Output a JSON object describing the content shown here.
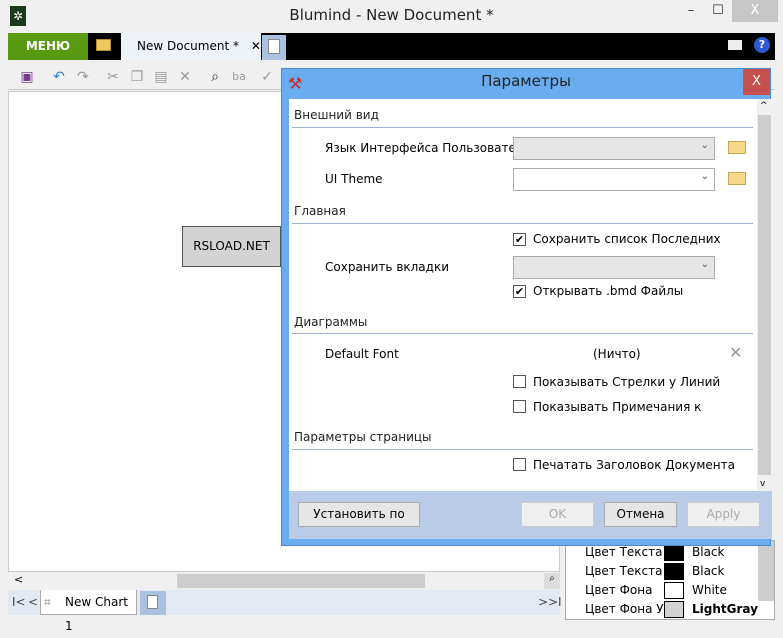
{
  "app": {
    "title": "Blumind - New Document *",
    "minimize": "–",
    "maximize": "☐",
    "close": "X"
  },
  "menubar": {
    "menu_label": "МЕНЮ",
    "doc_tab": "New Document *",
    "doc_tab_close": "✕"
  },
  "canvas": {
    "node_text": "RSLOAD.NET"
  },
  "bottom": {
    "chart_tab": "New Chart 1",
    "first": "I<",
    "prev": "<",
    "next": ">",
    "last": ">I"
  },
  "properties": [
    {
      "label": "Цвет Текста",
      "value": "Black",
      "color": "#000000"
    },
    {
      "label": "Цвет Текста У",
      "value": "Black",
      "color": "#000000"
    },
    {
      "label": "Цвет Фона",
      "value": "White",
      "color": "#ffffff"
    },
    {
      "label": "Цвет Фона Уз.",
      "value": "LightGray",
      "color": "#d3d3d3"
    }
  ],
  "dialog": {
    "title": "Параметры",
    "close": "X",
    "sections": {
      "appearance": "Внешний вид",
      "main": "Главная",
      "charts": "Диаграммы",
      "page": "Параметры страницы"
    },
    "ui_language_label": "Язык Интерфейса Пользователя",
    "ui_language_value": "",
    "ui_theme_label": "UI Theme",
    "ui_theme_value": "",
    "save_recent": {
      "label": "Сохранить список Последних",
      "checked": true
    },
    "save_tabs_label": "Сохранить вкладки",
    "save_tabs_value": "",
    "open_bmd": {
      "label": "Открывать .bmd Файлы",
      "checked": true
    },
    "default_font_label": "Default Font",
    "default_font_value": "(Ничто)",
    "show_arrows": {
      "label": "Показывать Стрелки у Линий",
      "checked": false
    },
    "show_notes": {
      "label": "Показывать Примечания к",
      "checked": false
    },
    "print_title": {
      "label": "Печатать Заголовок Документа",
      "checked": false
    },
    "buttons": {
      "defaults": "Установить по",
      "ok": "OK",
      "cancel": "Отмена",
      "apply": "Apply"
    }
  }
}
